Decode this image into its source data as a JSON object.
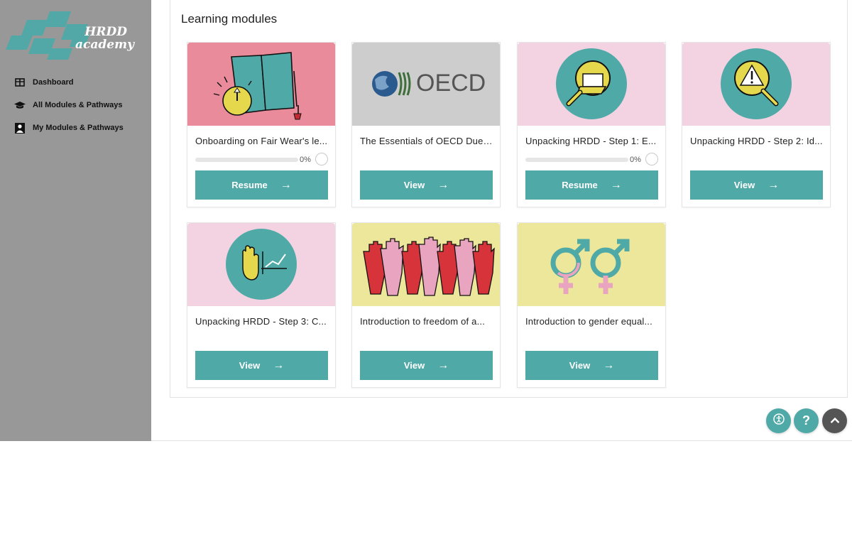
{
  "brand": {
    "line1": "HRDD",
    "line2": "academy",
    "accent": "#4fa9a7"
  },
  "sidebar": {
    "items": [
      {
        "label": "Dashboard",
        "icon": "dashboard-icon"
      },
      {
        "label": "All Modules & Pathways",
        "icon": "graduation-cap-icon"
      },
      {
        "label": "My Modules & Pathways",
        "icon": "user-book-icon"
      }
    ]
  },
  "main": {
    "section_title": "Learning modules",
    "cards": [
      {
        "title": "Onboarding on Fair Wear's le...",
        "progress": "0%",
        "progress_value": 0,
        "button": "Resume",
        "thumb": "book-clock",
        "thumb_bg": "#e77f8f"
      },
      {
        "title": "The Essentials of OECD Due ...",
        "button": "View",
        "thumb": "oecd-logo",
        "thumb_bg": "#c8c8c8",
        "logo_text": "OECD"
      },
      {
        "title": "Unpacking HRDD - Step 1: E...",
        "progress": "0%",
        "progress_value": 0,
        "button": "Resume",
        "thumb": "magnifier-folder",
        "thumb_bg": "#f2cfe0"
      },
      {
        "title": "Unpacking HRDD - Step 2: Id...",
        "button": "View",
        "thumb": "magnifier-warning",
        "thumb_bg": "#f2cfe0"
      },
      {
        "title": "Unpacking HRDD - Step 3: C...",
        "button": "View",
        "thumb": "hand-chart",
        "thumb_bg": "#f2cfe0"
      },
      {
        "title": "Introduction to freedom of a...",
        "button": "View",
        "thumb": "raised-hands",
        "thumb_bg": "#ece79a"
      },
      {
        "title": "Introduction to gender equal...",
        "button": "View",
        "thumb": "gender-symbols",
        "thumb_bg": "#ece79a"
      }
    ]
  },
  "fabs": [
    {
      "icon": "accessibility-icon"
    },
    {
      "icon": "help-icon",
      "glyph": "?"
    },
    {
      "icon": "chevron-up-icon"
    }
  ]
}
